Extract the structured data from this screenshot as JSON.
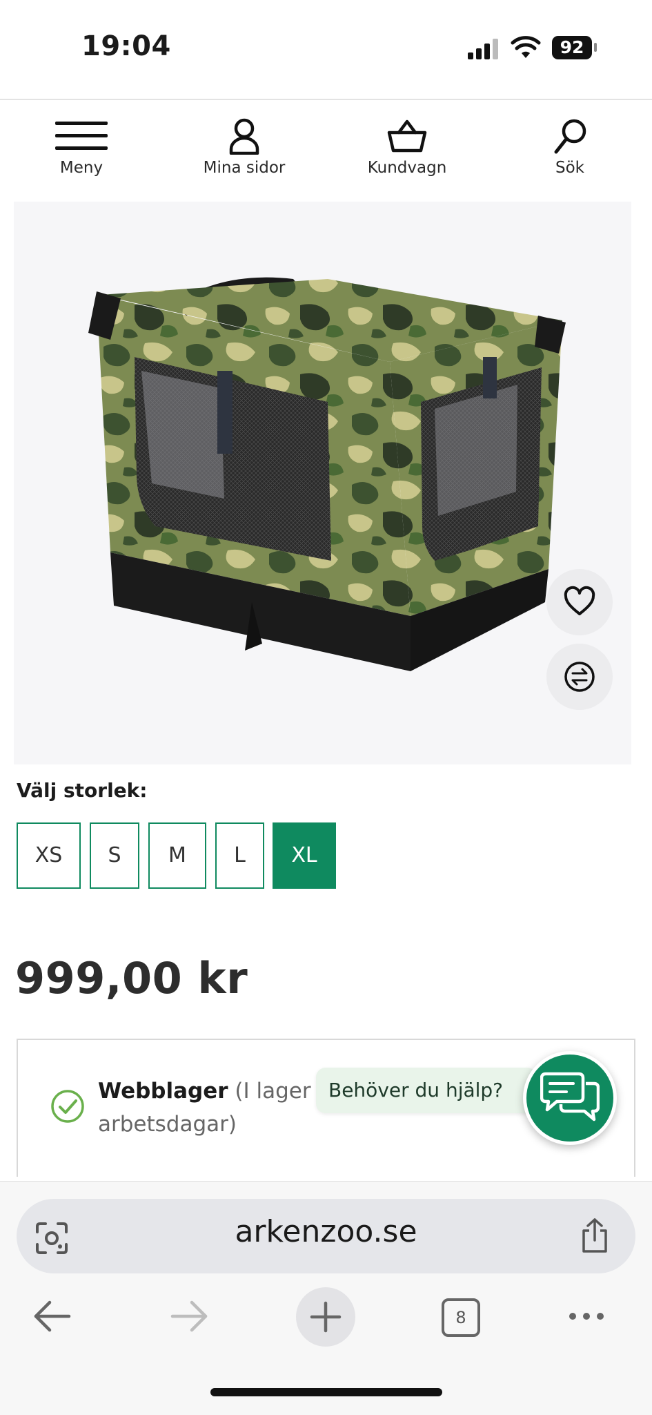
{
  "status_bar": {
    "time": "19:04",
    "battery": "92"
  },
  "nav": {
    "menu_label": "Meny",
    "account_label": "Mina sidor",
    "cart_label": "Kundvagn",
    "search_label": "Sök"
  },
  "product": {
    "size_label": "Välj storlek:",
    "sizes": [
      "XS",
      "S",
      "M",
      "L",
      "XL"
    ],
    "selected_size": "XL",
    "price": "999,00 kr",
    "stock_title": "Webblager",
    "stock_detail_1": " (I lager p",
    "stock_detail_2": "arbetsdagar)"
  },
  "help": {
    "bubble_text": "Behöver du hjälp?"
  },
  "browser": {
    "url": "arkenzoo.se",
    "tab_count": "8"
  },
  "colors": {
    "brand_green": "#0f8a5f",
    "check_green": "#6ab04c"
  },
  "icons": [
    "hamburger-icon",
    "person-icon",
    "basket-icon",
    "search-icon",
    "heart-icon",
    "compare-icon",
    "check-icon",
    "chat-icon",
    "lens-icon",
    "share-icon",
    "back-icon",
    "forward-icon",
    "plus-icon",
    "tabs-icon",
    "more-icon"
  ]
}
